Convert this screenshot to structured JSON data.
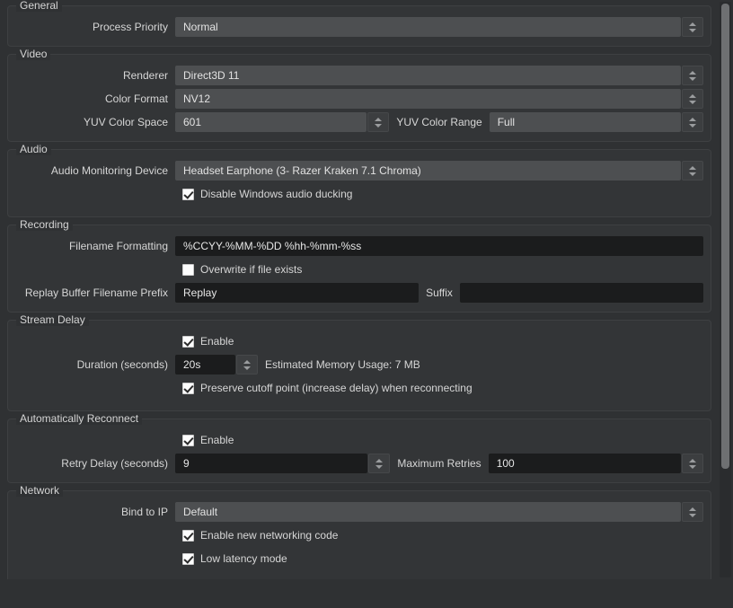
{
  "groups": [
    {
      "title": "General",
      "rows": [
        {
          "label": "Process Priority",
          "value": "Normal"
        }
      ]
    },
    {
      "title": "Video",
      "rows": [
        {
          "label": "Renderer",
          "value": "Direct3D 11"
        },
        {
          "label": "Color Format",
          "value": "NV12"
        },
        {
          "label": "YUV Color Space",
          "value": "601"
        },
        {
          "label2": "YUV Color Range",
          "value2": "Full"
        }
      ]
    },
    {
      "title": "Audio",
      "rows": [
        {
          "label": "Audio Monitoring Device",
          "value": "Headset Earphone (3- Razer Kraken 7.1 Chroma)"
        },
        {
          "checkbox": "Disable Windows audio ducking",
          "checked": true
        }
      ]
    },
    {
      "title": "Recording",
      "rows": [
        {
          "label": "Filename Formatting",
          "value": "%CCYY-%MM-%DD %hh-%mm-%ss"
        },
        {
          "checkbox": "Overwrite if file exists",
          "checked": false
        },
        {
          "label": "Replay Buffer Filename Prefix",
          "value": "Replay",
          "label2": "Suffix",
          "value2": ""
        }
      ]
    },
    {
      "title": "Stream Delay",
      "rows": [
        {
          "checkbox": "Enable",
          "checked": true
        },
        {
          "label": "Duration (seconds)",
          "value": "20s",
          "note": "Estimated Memory Usage: 7 MB"
        },
        {
          "checkbox": "Preserve cutoff point (increase delay) when reconnecting",
          "checked": true
        }
      ]
    },
    {
      "title": "Automatically Reconnect",
      "rows": [
        {
          "checkbox": "Enable",
          "checked": true
        },
        {
          "label": "Retry Delay (seconds)",
          "value": "9",
          "label2": "Maximum Retries",
          "value2": "100"
        }
      ]
    },
    {
      "title": "Network",
      "rows": [
        {
          "label": "Bind to IP",
          "value": "Default"
        },
        {
          "checkbox": "Enable new networking code",
          "checked": true
        },
        {
          "checkbox": "Low latency mode",
          "checked": true
        }
      ]
    }
  ],
  "general": {
    "title": "General",
    "process_priority_label": "Process Priority",
    "process_priority_value": "Normal"
  },
  "video": {
    "title": "Video",
    "renderer_label": "Renderer",
    "renderer_value": "Direct3D 11",
    "color_format_label": "Color Format",
    "color_format_value": "NV12",
    "yuv_color_space_label": "YUV Color Space",
    "yuv_color_space_value": "601",
    "yuv_color_range_label": "YUV Color Range",
    "yuv_color_range_value": "Full"
  },
  "audio": {
    "title": "Audio",
    "monitoring_device_label": "Audio Monitoring Device",
    "monitoring_device_value": "Headset Earphone (3- Razer Kraken 7.1 Chroma)",
    "ducking_label": "Disable Windows audio ducking",
    "ducking_checked": true
  },
  "recording": {
    "title": "Recording",
    "filename_formatting_label": "Filename Formatting",
    "filename_formatting_value": "%CCYY-%MM-%DD %hh-%mm-%ss",
    "overwrite_label": "Overwrite if file exists",
    "overwrite_checked": false,
    "replay_prefix_label": "Replay Buffer Filename Prefix",
    "replay_prefix_value": "Replay",
    "suffix_label": "Suffix",
    "suffix_value": ""
  },
  "stream_delay": {
    "title": "Stream Delay",
    "enable_label": "Enable",
    "enable_checked": true,
    "duration_label": "Duration (seconds)",
    "duration_value": "20s",
    "memory_note": "Estimated Memory Usage: 7 MB",
    "preserve_label": "Preserve cutoff point (increase delay) when reconnecting",
    "preserve_checked": true
  },
  "auto_reconnect": {
    "title": "Automatically Reconnect",
    "enable_label": "Enable",
    "enable_checked": true,
    "retry_delay_label": "Retry Delay (seconds)",
    "retry_delay_value": "9",
    "max_retries_label": "Maximum Retries",
    "max_retries_value": "100"
  },
  "network": {
    "title": "Network",
    "bind_to_ip_label": "Bind to IP",
    "bind_to_ip_value": "Default",
    "new_networking_label": "Enable new networking code",
    "new_networking_checked": true,
    "low_latency_label": "Low latency mode",
    "low_latency_checked": true
  },
  "colors": {
    "window_bg": "#2f3133",
    "group_bg": "#333537",
    "group_border": "#3e4042",
    "combo_bg": "#4d4f51",
    "input_bg": "#1b1c1d",
    "text": "#d6d6d6",
    "scroll_thumb": "#6e7072",
    "scroll_track": "#2a2c2e"
  },
  "icons": {
    "spin_up": "chevron-up-icon",
    "spin_down": "chevron-down-icon"
  }
}
